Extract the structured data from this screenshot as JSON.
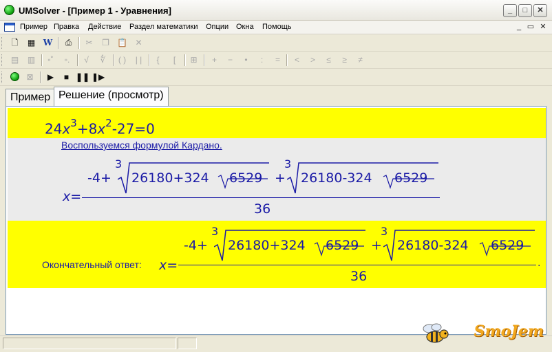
{
  "window": {
    "title": "UMSolver - [Пример 1 - Уравнения]",
    "min_label": "_",
    "max_label": "□",
    "close_label": "✕"
  },
  "menubar": {
    "items": [
      "Пример",
      "Правка",
      "Действие",
      "Раздел математики",
      "Опции",
      "Окна",
      "Помощь"
    ],
    "mdi_min": "_",
    "mdi_restore": "▭",
    "mdi_close": "✕"
  },
  "tabs": [
    {
      "label": "Пример",
      "active": false
    },
    {
      "label": "Решение (просмотр)",
      "active": true
    }
  ],
  "solution": {
    "equation": {
      "coef1": "24",
      "var": "x",
      "exp1": "3",
      "plus1": "+8",
      "exp2": "2",
      "rest": "-27=0"
    },
    "method_text": "Воспользуемся формулой Кардано.",
    "formula": {
      "lhs": "x",
      "eq": "=",
      "prefix": "-4+",
      "root_index": "3",
      "rad1_part": "26180+324",
      "inner": "6529",
      "plus": "+",
      "rad2_part": "26180-324",
      "denominator": "36"
    },
    "final_label": "Окончательный ответ:",
    "final_dot": "."
  },
  "watermark": "SmoJem",
  "colors": {
    "highlight": "#ffff00",
    "math_blue": "#1a1aa6",
    "app_icon": "#0a9a0a"
  }
}
